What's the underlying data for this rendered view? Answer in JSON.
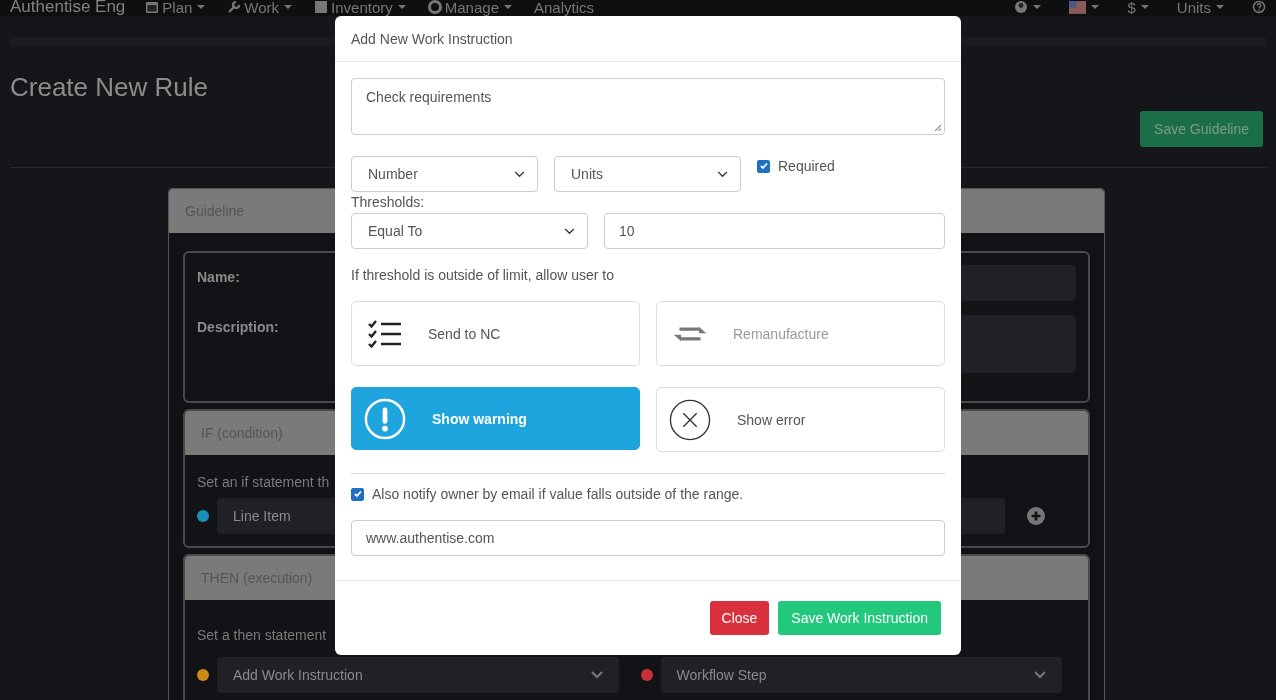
{
  "navbar": {
    "brand": "Authentise Eng",
    "menu": [
      {
        "label": "Plan",
        "dropdown": true
      },
      {
        "label": "Work",
        "dropdown": true
      },
      {
        "label": "Inventory",
        "dropdown": true
      },
      {
        "label": "Manage",
        "dropdown": true
      },
      {
        "label": "Analytics",
        "dropdown": false
      }
    ],
    "right_menu": [
      {
        "label": "$"
      },
      {
        "label": "Units"
      }
    ]
  },
  "page": {
    "title": "Create New Rule",
    "save_button": "Save Guideline",
    "guideline": {
      "header": "Guideline",
      "name_label": "Name:",
      "description_label": "Description:"
    },
    "if_panel": {
      "header": "IF (condition)",
      "text": "Set an if statement th",
      "selects": [
        {
          "value": "Line Item",
          "color": "#1a8fb8"
        }
      ]
    },
    "then_panel": {
      "header": "THEN (execution)",
      "text": "Set a then statement",
      "selects": [
        {
          "value": "Add Work Instruction",
          "color": "#c98a16"
        },
        {
          "value": "Workflow Step",
          "color": "#c8303c"
        }
      ]
    }
  },
  "modal": {
    "title": "Add New Work Instruction",
    "description": "Check requirements",
    "type_select": "Number",
    "units_select": "Units",
    "required": {
      "label": "Required",
      "checked": true
    },
    "thresholds_label": "Thresholds:",
    "comparison_select": "Equal To",
    "threshold_value": "10",
    "options_label": "If threshold is outside of limit, allow user to",
    "options": [
      {
        "kind": "checklist",
        "label": "Send to NC",
        "selected": false,
        "disabled": false
      },
      {
        "kind": "repeat",
        "label": "Remanufacture",
        "selected": false,
        "disabled": true
      },
      {
        "kind": "warning",
        "label": "Show warning",
        "selected": true,
        "disabled": false
      },
      {
        "kind": "error",
        "label": "Show error",
        "selected": false,
        "disabled": false
      }
    ],
    "notify": {
      "label": "Also notify owner by email if value falls outside of the range.",
      "checked": true
    },
    "email_field": "www.authentise.com",
    "buttons": {
      "close": "Close",
      "save": "Save Work Instruction"
    }
  }
}
